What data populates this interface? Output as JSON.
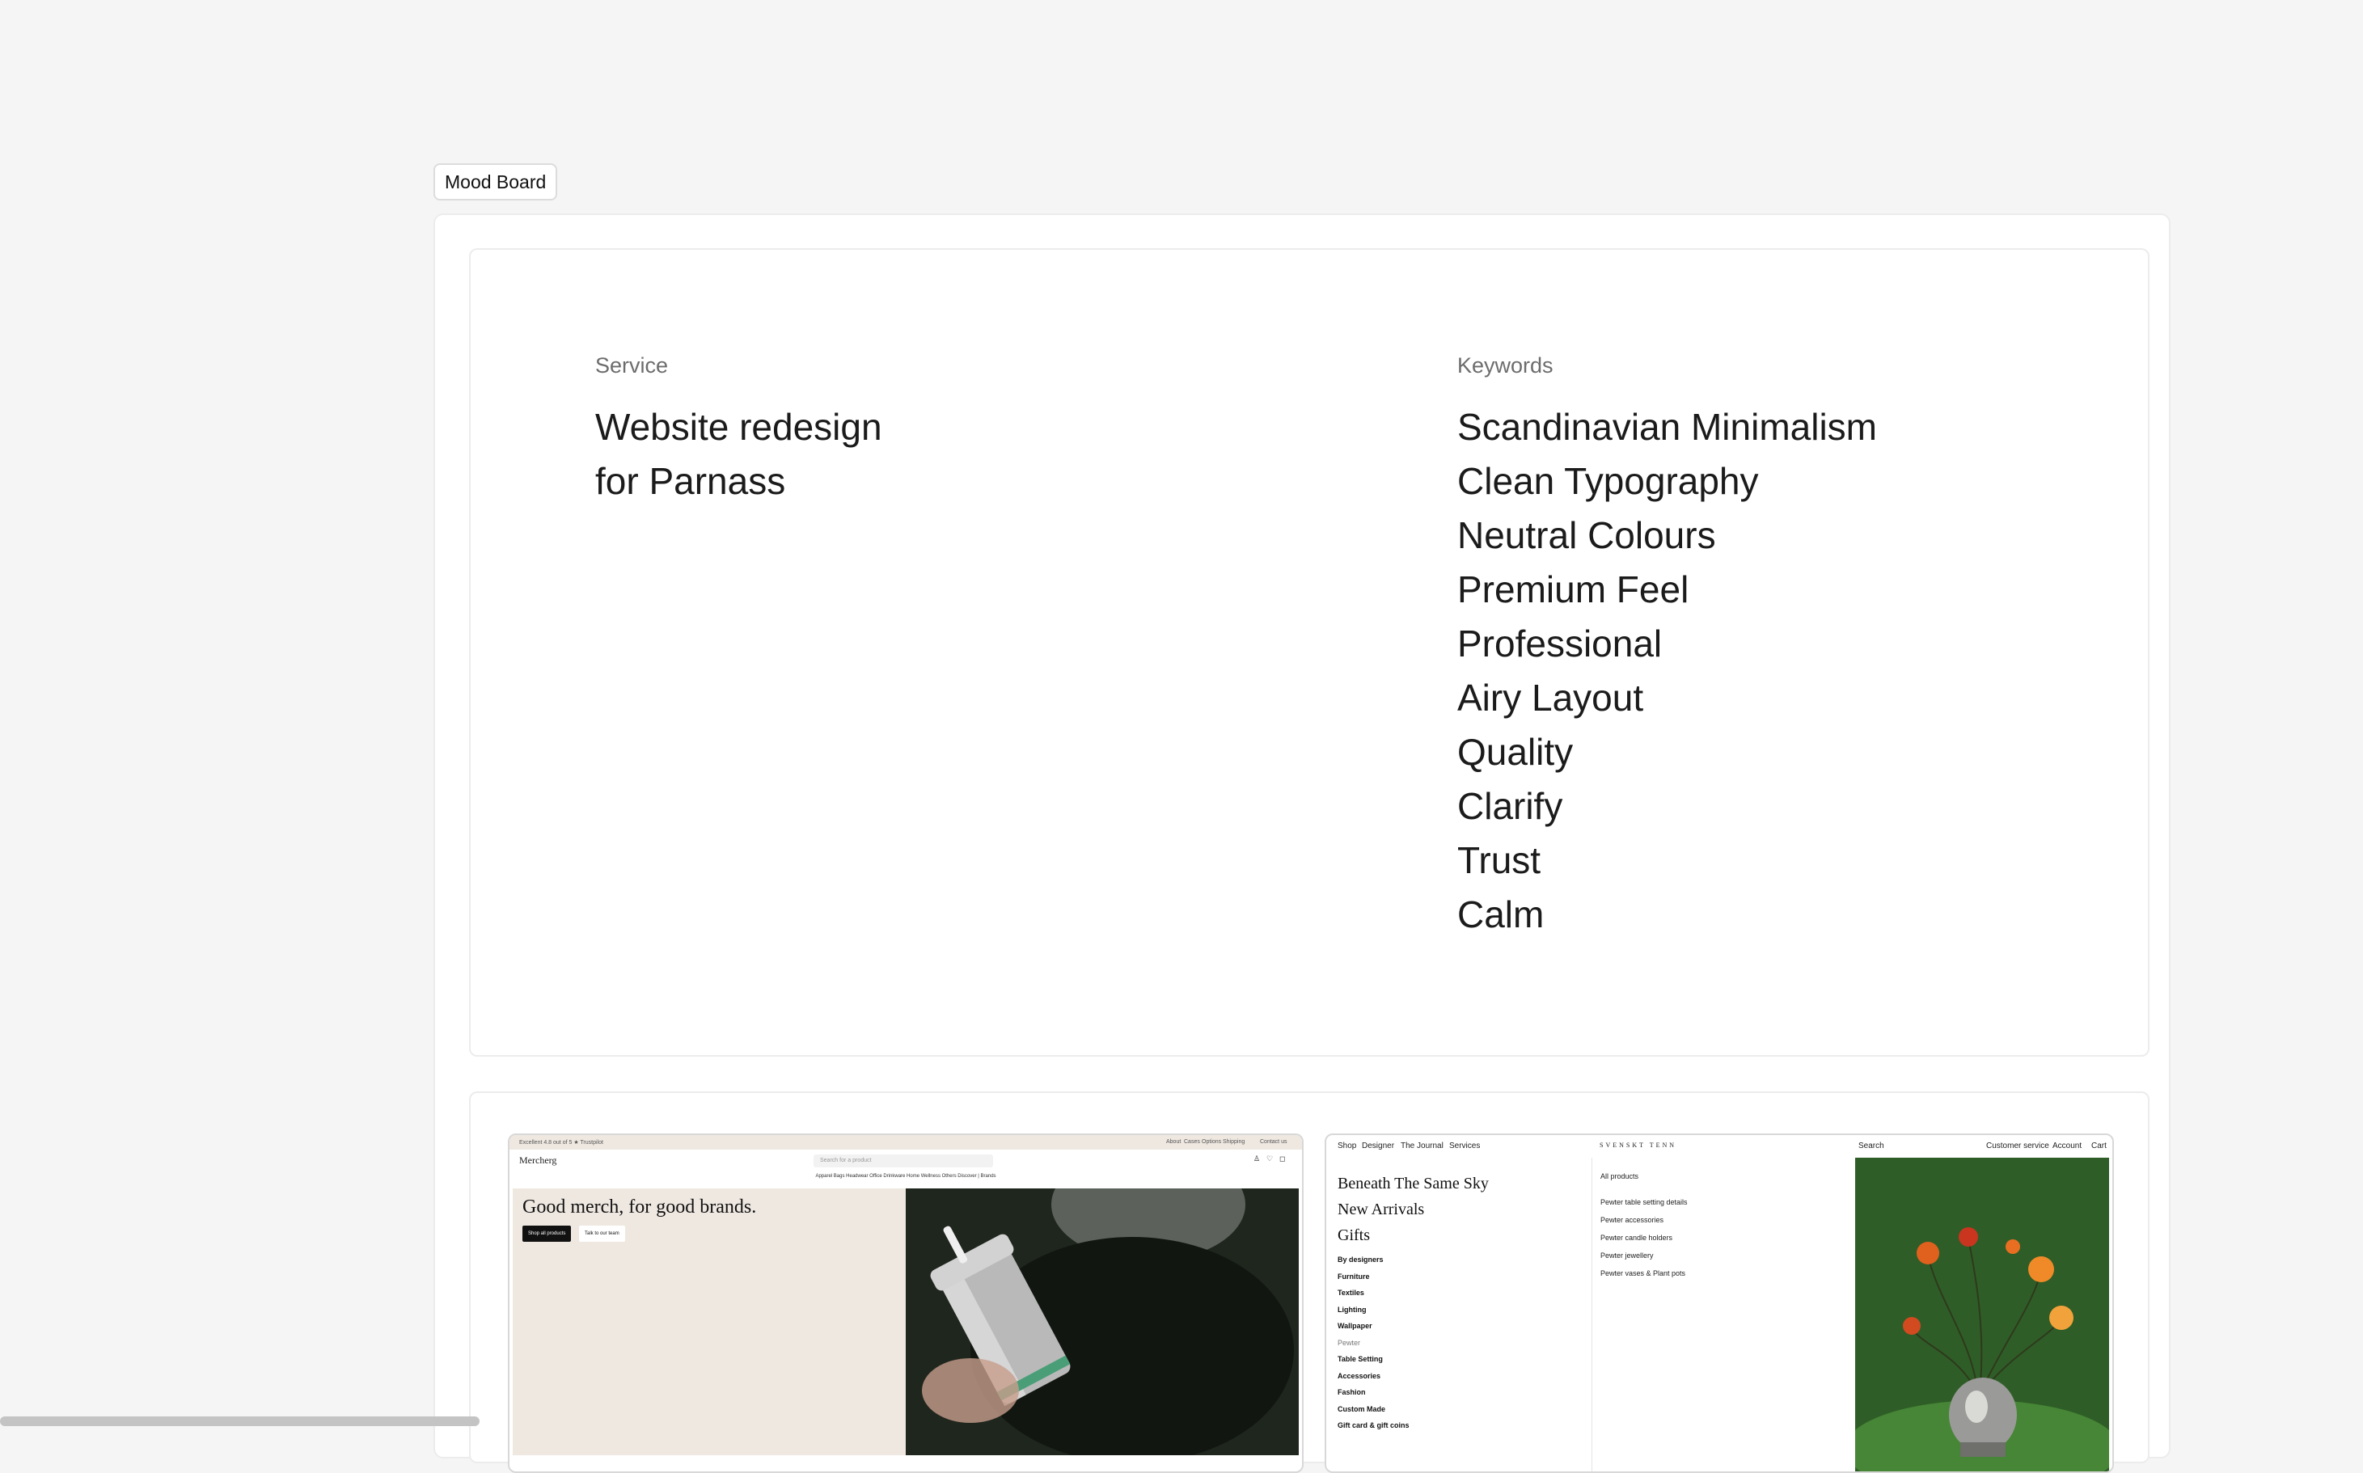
{
  "board_tag": "Mood Board",
  "service": {
    "label": "Service",
    "title_line1": "Website redesign",
    "title_line2": "for Parnass"
  },
  "keywords": {
    "label": "Keywords",
    "items": [
      "Scandinavian Minimalism",
      "Clean Typography",
      "Neutral Colours",
      "Premium Feel",
      "Professional",
      "Airy Layout",
      "Quality",
      "Clarify",
      "Trust",
      "Calm"
    ]
  },
  "mercherg": {
    "trustpilot": "Excellent  4.8 out of 5  ★ Trustpilot",
    "top_links": [
      "About",
      "Cases",
      "Options",
      "Shipping",
      "Contact us"
    ],
    "logo": "Mercherg",
    "search_placeholder": "Search for a product",
    "categories": "Apparel   Bags   Headwear   Office   Drinkware   Home   Wellness   Others   Discover   |   Brands",
    "headline": "Good merch, for good brands.",
    "cta_primary": "Shop all products",
    "cta_secondary": "Talk to our team",
    "colors": {
      "hero_bg": "#efe8e1",
      "cta_bg": "#111111"
    }
  },
  "svenskt": {
    "nav_left": [
      "Shop",
      "Designer",
      "The Journal",
      "Services"
    ],
    "logo": "SVENSKT TENN",
    "nav_right": [
      "Search",
      "Customer service",
      "Account",
      "Cart"
    ],
    "serif_links": [
      "Beneath The Same Sky",
      "New Arrivals",
      "Gifts"
    ],
    "menu": [
      "By designers",
      "Furniture",
      "Textiles",
      "Lighting",
      "Wallpaper",
      "Pewter",
      "Table Setting",
      "Accessories",
      "Fashion",
      "Custom Made",
      "Gift card & gift coins"
    ],
    "submenu_title": "All products",
    "submenu": [
      "Pewter table setting details",
      "Pewter accessories",
      "Pewter candle holders",
      "Pewter jewellery",
      "Pewter vases & Plant pots"
    ],
    "colors": {
      "image_bg": "#2f5d27"
    }
  }
}
